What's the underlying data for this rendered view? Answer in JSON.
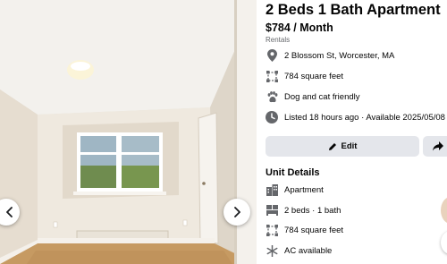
{
  "listing": {
    "title": "2 Beds 1 Bath Apartment",
    "price": "$784 / Month",
    "category": "Rentals"
  },
  "info_rows": [
    {
      "icon": "location-pin-icon",
      "text": "2 Blossom St, Worcester, MA"
    },
    {
      "icon": "square-feet-icon",
      "text": "784 square feet"
    },
    {
      "icon": "paw-icon",
      "text": "Dog and cat friendly"
    },
    {
      "icon": "clock-icon",
      "text": "Listed 18 hours ago · Available 2025/05/08"
    }
  ],
  "actions": {
    "edit_label": "Edit",
    "share_icon": "share-arrow-icon"
  },
  "unit_details": {
    "heading": "Unit Details",
    "items": [
      {
        "icon": "building-icon",
        "text": "Apartment"
      },
      {
        "icon": "bed-icon",
        "text": "2 beds · 1 bath"
      },
      {
        "icon": "square-feet-icon",
        "text": "784 square feet"
      },
      {
        "icon": "snowflake-icon",
        "text": "AC available"
      }
    ]
  },
  "gallery": {
    "prev_icon": "chevron-left-icon",
    "next_icon": "chevron-right-icon"
  },
  "colors": {
    "button_bg": "#e4e6eb",
    "secondary_text": "#65676b",
    "icon_gray": "#65676b"
  }
}
